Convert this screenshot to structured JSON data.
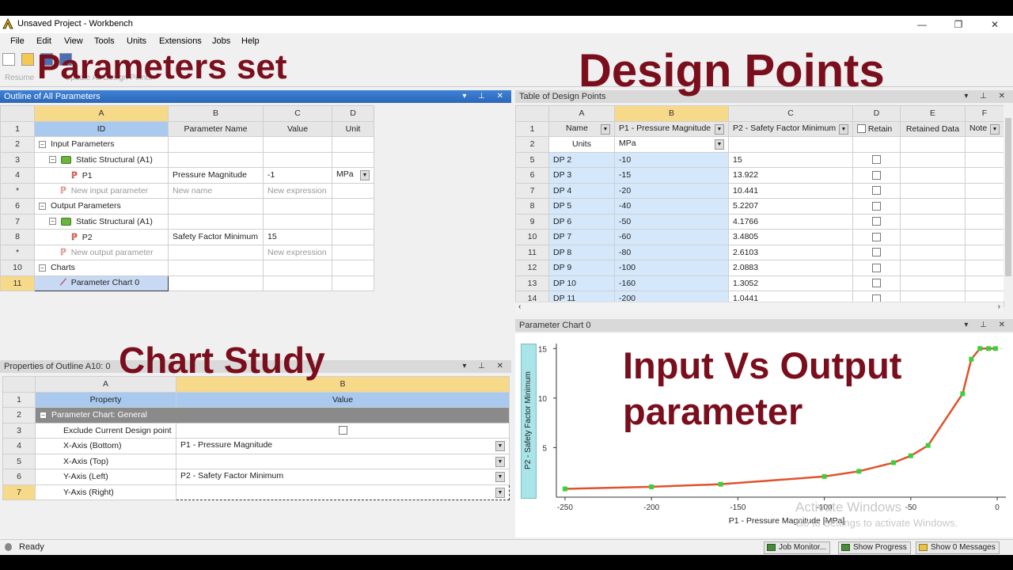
{
  "window": {
    "title": "Unsaved Project - Workbench",
    "minimize": "—",
    "restore": "❐",
    "close": "✕"
  },
  "menu": [
    "File",
    "Edit",
    "View",
    "Tools",
    "Units",
    "Extensions",
    "Jobs",
    "Help"
  ],
  "toolbar": {
    "resume": "Resume",
    "update": "Update All Design Points"
  },
  "overlays": {
    "params_set": "Parameters set",
    "design_points": "Design Points",
    "chart_study": "Chart Study",
    "input_vs_output_1": "Input Vs Output",
    "input_vs_output_2": "parameter"
  },
  "outline": {
    "title": "Outline of All Parameters",
    "cols": [
      "A",
      "B",
      "C",
      "D"
    ],
    "headers": {
      "id": "ID",
      "name": "Parameter Name",
      "value": "Value",
      "unit": "Unit"
    },
    "rows": [
      {
        "n": "2",
        "id": "Input Parameters",
        "name": "",
        "value": "",
        "unit": ""
      },
      {
        "n": "3",
        "id": "Static Structural (A1)",
        "name": "",
        "value": "",
        "unit": ""
      },
      {
        "n": "4",
        "id": "P1",
        "name": "Pressure Magnitude",
        "value": "-1",
        "unit": "MPa"
      },
      {
        "n": "*",
        "id": "New input parameter",
        "name": "New name",
        "value": "New expression",
        "unit": ""
      },
      {
        "n": "6",
        "id": "Output Parameters",
        "name": "",
        "value": "",
        "unit": ""
      },
      {
        "n": "7",
        "id": "Static Structural (A1)",
        "name": "",
        "value": "",
        "unit": ""
      },
      {
        "n": "8",
        "id": "P2",
        "name": "Safety Factor Minimum",
        "value": "15",
        "unit": ""
      },
      {
        "n": "*",
        "id": "New output parameter",
        "name": "",
        "value": "New expression",
        "unit": ""
      },
      {
        "n": "10",
        "id": "Charts",
        "name": "",
        "value": "",
        "unit": ""
      },
      {
        "n": "11",
        "id": "Parameter Chart 0",
        "name": "",
        "value": "",
        "unit": ""
      }
    ]
  },
  "properties": {
    "title": "Properties of Outline A10: 0",
    "cols": [
      "A",
      "B"
    ],
    "headers": {
      "property": "Property",
      "value": "Value"
    },
    "group": "Parameter Chart: General",
    "rows": [
      {
        "n": "3",
        "prop": "Exclude Current Design point",
        "value": ""
      },
      {
        "n": "4",
        "prop": "X-Axis (Bottom)",
        "value": "P1 - Pressure Magnitude"
      },
      {
        "n": "5",
        "prop": "X-Axis (Top)",
        "value": ""
      },
      {
        "n": "6",
        "prop": "Y-Axis (Left)",
        "value": "P2 - Safety Factor Minimum"
      },
      {
        "n": "7",
        "prop": "Y-Axis (Right)",
        "value": ""
      }
    ]
  },
  "design_points": {
    "title": "Table of Design Points",
    "cols": [
      "A",
      "B",
      "C",
      "D",
      "E",
      "F"
    ],
    "headers": {
      "name": "Name",
      "p1": "P1 - Pressure Magnitude",
      "p2": "P2 - Safety Factor Minimum",
      "retain": "Retain",
      "retained": "Retained Data",
      "note": "Note"
    },
    "units_label": "Units",
    "units_value": "MPa",
    "rows": [
      {
        "n": "5",
        "name": "DP 2",
        "p1": "-10",
        "p2": "15"
      },
      {
        "n": "6",
        "name": "DP 3",
        "p1": "-15",
        "p2": "13.922"
      },
      {
        "n": "7",
        "name": "DP 4",
        "p1": "-20",
        "p2": "10.441"
      },
      {
        "n": "8",
        "name": "DP 5",
        "p1": "-40",
        "p2": "5.2207"
      },
      {
        "n": "9",
        "name": "DP 6",
        "p1": "-50",
        "p2": "4.1766"
      },
      {
        "n": "10",
        "name": "DP 7",
        "p1": "-60",
        "p2": "3.4805"
      },
      {
        "n": "11",
        "name": "DP 8",
        "p1": "-80",
        "p2": "2.6103"
      },
      {
        "n": "12",
        "name": "DP 9",
        "p1": "-100",
        "p2": "2.0883"
      },
      {
        "n": "13",
        "name": "DP 10",
        "p1": "-160",
        "p2": "1.3052"
      },
      {
        "n": "14",
        "name": "DP 11",
        "p1": "-200",
        "p2": "1.0441"
      }
    ]
  },
  "chart_panel": {
    "title": "Parameter Chart 0"
  },
  "chart_data": {
    "type": "line",
    "xlabel": "P1 - Pressure Magnitude [MPa]",
    "ylabel": "P2 - Safety Factor Minimum",
    "xlim": [
      -255,
      5
    ],
    "ylim": [
      0,
      15.5
    ],
    "xticks": [
      -250,
      -200,
      -150,
      -100,
      -50,
      0
    ],
    "yticks": [
      5,
      10,
      15
    ],
    "line_color": "#e0522b",
    "marker_color": "#3ccf3c",
    "points": [
      {
        "x": -250,
        "y": 0.835
      },
      {
        "x": -200,
        "y": 1.0441
      },
      {
        "x": -160,
        "y": 1.3052
      },
      {
        "x": -100,
        "y": 2.0883
      },
      {
        "x": -80,
        "y": 2.6103
      },
      {
        "x": -60,
        "y": 3.4805
      },
      {
        "x": -50,
        "y": 4.1766
      },
      {
        "x": -40,
        "y": 5.2207
      },
      {
        "x": -20,
        "y": 10.441
      },
      {
        "x": -15,
        "y": 13.922
      },
      {
        "x": -10,
        "y": 15
      },
      {
        "x": -5,
        "y": 15
      },
      {
        "x": -1,
        "y": 15
      }
    ]
  },
  "watermark": {
    "line1": "Activate Windows",
    "line2": "Go to Settings to activate Windows."
  },
  "status": {
    "ready": "Ready",
    "job_monitor": "Job Monitor...",
    "show_progress": "Show Progress",
    "show_messages": "Show 0 Messages"
  }
}
